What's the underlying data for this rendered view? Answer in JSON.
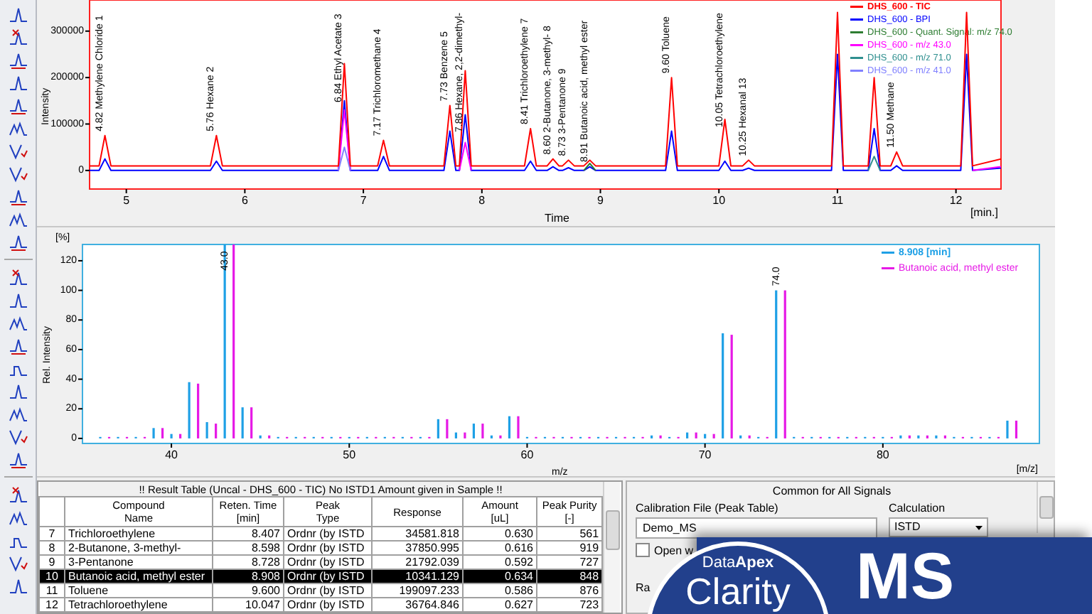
{
  "chromatogram": {
    "unit_x": "[min.]",
    "chart_data": {
      "type": "line",
      "xlabel": "Time",
      "ylabel": "Intensity",
      "xlim": [
        4.69,
        12.38
      ],
      "ylim": [
        -40000,
        367000
      ],
      "xticks": [
        5,
        6,
        7,
        8,
        9,
        10,
        11,
        12
      ],
      "yticks": [
        0,
        100000,
        200000,
        300000
      ],
      "legend": "upper right",
      "x": [
        4.69,
        4.77,
        4.82,
        4.87,
        5.71,
        5.76,
        5.81,
        6.79,
        6.84,
        6.89,
        7.12,
        7.17,
        7.22,
        7.68,
        7.73,
        7.78,
        7.81,
        7.86,
        7.91,
        8.36,
        8.41,
        8.46,
        8.55,
        8.6,
        8.65,
        8.68,
        8.73,
        8.78,
        8.86,
        8.91,
        8.96,
        9.55,
        9.6,
        9.65,
        10,
        10.05,
        10.1,
        10.2,
        10.25,
        10.3,
        10.95,
        11,
        11.05,
        11.26,
        11.31,
        11.36,
        11.45,
        11.5,
        11.55,
        12.04,
        12.09,
        12.14,
        12.38
      ],
      "series": [
        {
          "name": "DHS_600 - TIC",
          "color": "#ff0000",
          "values": [
            10000,
            10000,
            75000,
            10000,
            10000,
            75000,
            10000,
            10000,
            230000,
            10000,
            10000,
            65000,
            10000,
            10000,
            140000,
            10000,
            10000,
            215000,
            10000,
            10000,
            90000,
            10000,
            10000,
            25000,
            10000,
            10000,
            22000,
            10000,
            10000,
            22000,
            10000,
            10000,
            200000,
            10000,
            10000,
            110000,
            10000,
            10000,
            22000,
            10000,
            10000,
            340000,
            10000,
            10000,
            200000,
            10000,
            10000,
            40000,
            10000,
            10000,
            340000,
            10000,
            25000
          ]
        },
        {
          "name": "DHS_600 - BPI",
          "color": "#0000ff",
          "values": [
            0,
            0,
            25000,
            0,
            0,
            20000,
            0,
            0,
            150000,
            0,
            0,
            30000,
            0,
            0,
            85000,
            0,
            0,
            120000,
            0,
            0,
            20000,
            0,
            0,
            8000,
            0,
            0,
            6000,
            0,
            0,
            8000,
            0,
            0,
            85000,
            0,
            0,
            20000,
            0,
            0,
            5000,
            0,
            0,
            250000,
            0,
            0,
            90000,
            0,
            0,
            10000,
            0,
            0,
            250000,
            0,
            5000
          ]
        },
        {
          "name": "DHS_600 - Quant. Signal: m/z 74.0",
          "color": "#2e7d32",
          "values": [
            null,
            null,
            null,
            null,
            null,
            null,
            null,
            null,
            null,
            null,
            null,
            null,
            null,
            null,
            null,
            null,
            null,
            null,
            null,
            null,
            null,
            null,
            null,
            null,
            null,
            null,
            null,
            null,
            0,
            15000,
            0,
            null,
            null,
            null,
            null,
            null,
            null,
            null,
            null,
            null,
            null,
            null,
            null,
            null,
            null,
            null,
            null,
            null,
            null,
            null,
            null,
            null,
            null
          ]
        },
        {
          "name": "DHS_600 - m/z 43.0",
          "color": "#ff00ff",
          "values": [
            null,
            null,
            null,
            null,
            null,
            null,
            null,
            0,
            130000,
            0,
            null,
            null,
            null,
            null,
            null,
            null,
            0,
            60000,
            0,
            null,
            null,
            null,
            null,
            null,
            null,
            null,
            null,
            null,
            null,
            null,
            null,
            null,
            null,
            null,
            null,
            null,
            null,
            null,
            null,
            null,
            null,
            null,
            null,
            null,
            null,
            null,
            null,
            null,
            null,
            null,
            null,
            0,
            8000
          ]
        },
        {
          "name": "DHS_600 - m/z 71.0",
          "color": "#2f8f8f",
          "values": [
            null,
            null,
            null,
            null,
            null,
            null,
            null,
            null,
            null,
            null,
            null,
            null,
            null,
            null,
            null,
            null,
            null,
            null,
            null,
            null,
            null,
            null,
            null,
            null,
            null,
            null,
            null,
            null,
            null,
            null,
            null,
            null,
            null,
            null,
            null,
            null,
            null,
            null,
            null,
            null,
            null,
            null,
            null,
            0,
            30000,
            0,
            null,
            null,
            null,
            null,
            null,
            null,
            null
          ]
        },
        {
          "name": "DHS_600 - m/z 41.0",
          "color": "#8080ff",
          "values": [
            null,
            null,
            null,
            null,
            null,
            null,
            null,
            0,
            50000,
            0,
            null,
            null,
            null,
            null,
            null,
            null,
            null,
            null,
            null,
            null,
            null,
            null,
            null,
            null,
            null,
            null,
            null,
            null,
            null,
            null,
            null,
            null,
            null,
            null,
            null,
            null,
            null,
            null,
            null,
            null,
            null,
            null,
            null,
            null,
            null,
            null,
            null,
            null,
            null,
            null,
            null,
            null,
            null
          ]
        }
      ],
      "annotations": [
        {
          "x": 4.82,
          "y": 75000,
          "text": "4.82 Methylene Chloride 1"
        },
        {
          "x": 5.76,
          "y": 75000,
          "text": "5.76 Hexane 2"
        },
        {
          "x": 6.84,
          "y": 230000,
          "text": "6.84 Ethyl Acetate 3"
        },
        {
          "x": 7.17,
          "y": 65000,
          "text": "7.17 Trichloromethane 4"
        },
        {
          "x": 7.73,
          "y": 140000,
          "text": "7.73 Benzene 5"
        },
        {
          "x": 7.86,
          "y": 215000,
          "text": "7.86 Hexane, 2,2-dimethyl-"
        },
        {
          "x": 8.41,
          "y": 90000,
          "text": "8.41 Trichloroethylene 7"
        },
        {
          "x": 8.6,
          "y": 25000,
          "text": "8.60 2-Butanone, 3-methyl- 8"
        },
        {
          "x": 8.73,
          "y": 22000,
          "text": "8.73 3-Pentanone 9"
        },
        {
          "x": 8.91,
          "y": 22000,
          "text": "8.91 Butanoic acid, methyl ester"
        },
        {
          "x": 9.6,
          "y": 200000,
          "text": "9.60 Toluene"
        },
        {
          "x": 10.05,
          "y": 110000,
          "text": "10.05 Tetrachloroethylene"
        },
        {
          "x": 10.25,
          "y": 22000,
          "text": "10.25 Hexanal 13"
        },
        {
          "x": 11.5,
          "y": 40000,
          "text": "11.50 Methane"
        }
      ]
    }
  },
  "spectrum": {
    "unit_y": "[%]",
    "unit_x": "[m/z]",
    "chart_data": {
      "type": "bar",
      "xlabel": "m/z",
      "ylabel": "Rel. Intensity",
      "xlim": [
        35,
        88.8
      ],
      "ylim": [
        -3.4,
        131
      ],
      "xticks": [
        40,
        50,
        60,
        70,
        80
      ],
      "yticks": [
        0,
        20,
        40,
        60,
        80,
        100,
        120
      ],
      "legend": "upper right",
      "x": [
        36,
        37,
        38,
        39,
        40,
        41,
        42,
        43,
        44,
        45,
        46,
        47,
        48,
        49,
        50,
        51,
        52,
        53,
        54,
        55,
        56,
        57,
        58,
        59,
        60,
        61,
        62,
        63,
        64,
        65,
        66,
        67,
        68,
        69,
        70,
        71,
        72,
        73,
        74,
        75,
        76,
        77,
        78,
        79,
        80,
        81,
        82,
        83,
        84,
        85,
        86,
        87
      ],
      "series": [
        {
          "name": "8.908 [min]",
          "color": "#1ea0e6",
          "values": [
            1,
            1,
            1,
            7,
            3,
            38,
            11,
            131,
            21,
            2,
            1,
            1,
            1,
            1,
            1,
            1,
            1,
            1,
            1,
            13,
            4,
            10,
            2,
            15,
            1,
            1,
            1,
            1,
            1,
            1,
            1,
            2,
            1,
            4,
            3,
            71,
            2,
            1,
            100,
            1,
            1,
            1,
            1,
            1,
            1,
            2,
            2,
            2,
            1,
            1,
            1,
            12
          ]
        },
        {
          "name": "Butanoic acid, methyl ester",
          "color": "#e619e6",
          "values": [
            1,
            1,
            1,
            7,
            3,
            37,
            10,
            131,
            21,
            2,
            1,
            1,
            1,
            1,
            1,
            1,
            1,
            1,
            1,
            13,
            4,
            10,
            2,
            15,
            1,
            1,
            1,
            1,
            1,
            1,
            1,
            2,
            1,
            4,
            3,
            70,
            2,
            1,
            100,
            1,
            1,
            1,
            1,
            1,
            1,
            2,
            2,
            2,
            1,
            1,
            1,
            12
          ]
        }
      ],
      "annotations": [
        {
          "x": 43,
          "y": 131,
          "text": "43.0"
        },
        {
          "x": 74,
          "y": 100,
          "text": "74.0"
        }
      ]
    }
  },
  "result_table": {
    "title": "!! Result Table (Uncal - DHS_600 - TIC) No ISTD1 Amount given in Sample !!",
    "columns": [
      "Compound\nName",
      "Reten. Time\n[min]",
      "Peak\nType",
      "Response",
      "Amount\n[uL]",
      "Peak Purity\n[-]"
    ],
    "rows": [
      {
        "index": "7",
        "selected": false,
        "cells": [
          "Trichloroethylene",
          "8.407",
          "Ordnr (by ISTD",
          "34581.818",
          "0.630",
          "561"
        ]
      },
      {
        "index": "8",
        "selected": false,
        "cells": [
          "2-Butanone, 3-methyl-",
          "8.598",
          "Ordnr (by ISTD",
          "37850.995",
          "0.616",
          "919"
        ]
      },
      {
        "index": "9",
        "selected": false,
        "cells": [
          "3-Pentanone",
          "8.728",
          "Ordnr (by ISTD",
          "21792.039",
          "0.592",
          "727"
        ]
      },
      {
        "index": "10",
        "selected": true,
        "cells": [
          "Butanoic acid, methyl ester",
          "8.908",
          "Ordnr (by ISTD",
          "10341.129",
          "0.634",
          "848"
        ]
      },
      {
        "index": "11",
        "selected": false,
        "cells": [
          "Toluene",
          "9.600",
          "Ordnr (by ISTD",
          "199097.233",
          "0.586",
          "876"
        ]
      },
      {
        "index": "12",
        "selected": false,
        "cells": [
          "Tetrachloroethylene",
          "10.047",
          "Ordnr (by ISTD",
          "36764.846",
          "0.627",
          "723"
        ]
      }
    ]
  },
  "signals_pane": {
    "title": "Common for All Signals",
    "calibration_label": "Calibration File (Peak Table)",
    "calibration_value": "Demo_MS",
    "calculation_label": "Calculation",
    "calculation_value": "ISTD",
    "open_checkbox": {
      "label": "Open w",
      "checked": false
    },
    "cut_label": "Ra"
  },
  "logo": {
    "brand": "Data**Apex**",
    "product": "Clarity",
    "edition": "MS"
  }
}
